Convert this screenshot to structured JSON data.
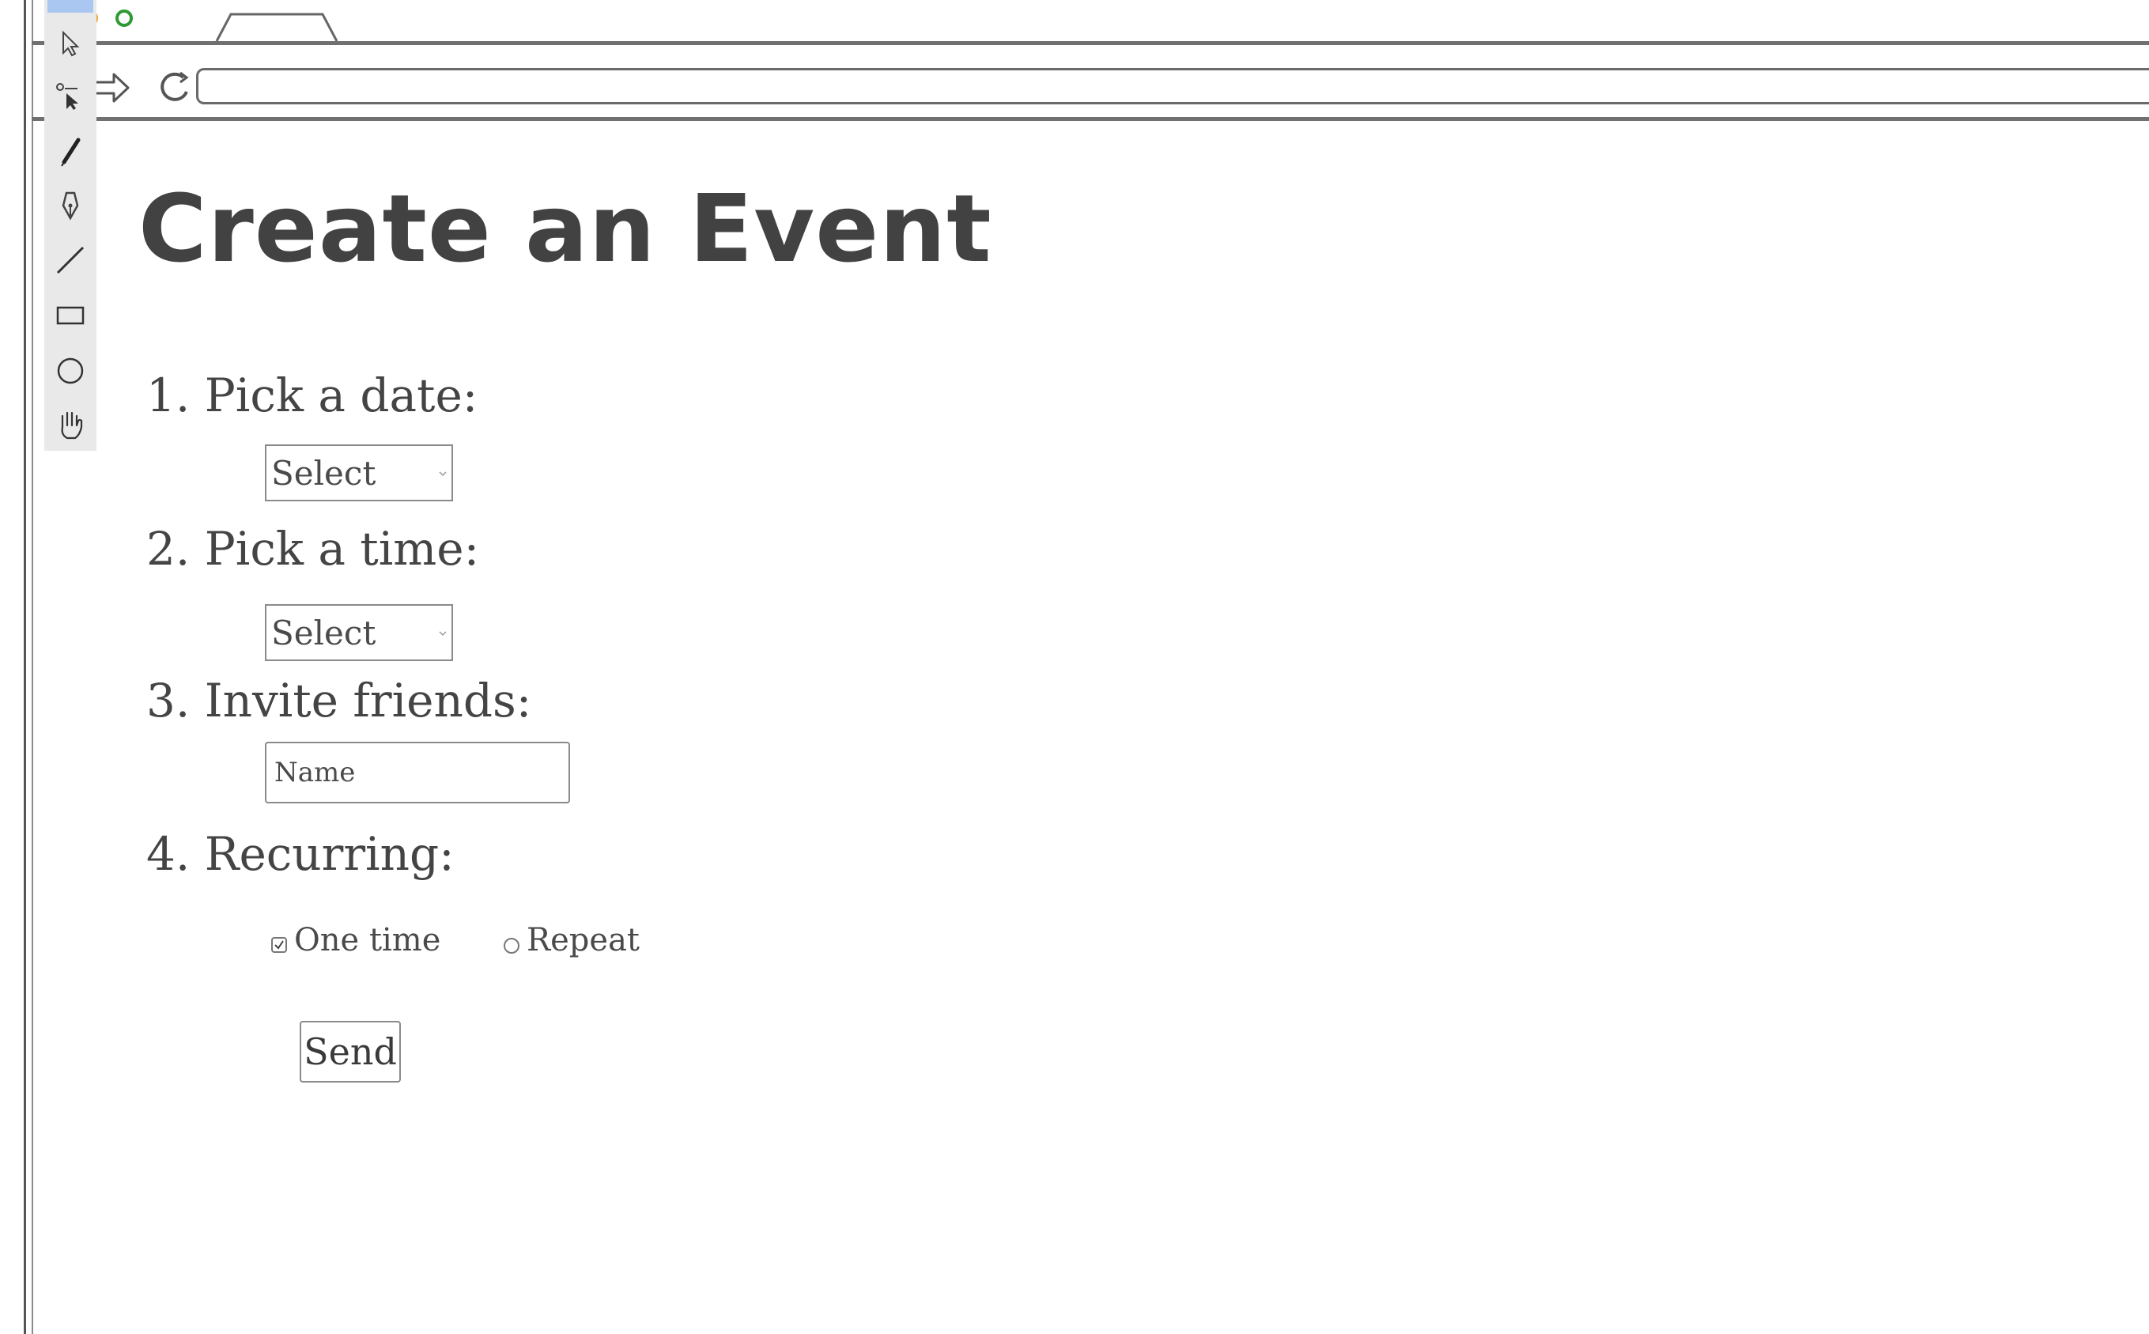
{
  "page": {
    "title": "Create an Event"
  },
  "steps": [
    {
      "label": "1. Pick a date:"
    },
    {
      "label": "2. Pick a time:"
    },
    {
      "label": "3. Invite friends:"
    },
    {
      "label": "4. Recurring:"
    }
  ],
  "date_select": {
    "value": "Select"
  },
  "time_select": {
    "value": "Select"
  },
  "invite": {
    "placeholder": "Name"
  },
  "recurring": {
    "options": [
      {
        "label": "One time",
        "checked": true
      },
      {
        "label": "Repeat",
        "checked": false
      }
    ]
  },
  "send_button": {
    "label": "Send"
  },
  "tools": [
    "pointer-icon",
    "direct-select-icon",
    "pencil-icon",
    "pen-icon",
    "line-icon",
    "rectangle-icon",
    "ellipse-icon",
    "hand-icon"
  ],
  "colors": {
    "palette_bg": "#e9e9e9",
    "active_tool": "#a9c7f0",
    "text": "#444444",
    "window_green": "#2e9a33",
    "window_orange": "#f0a13a"
  }
}
